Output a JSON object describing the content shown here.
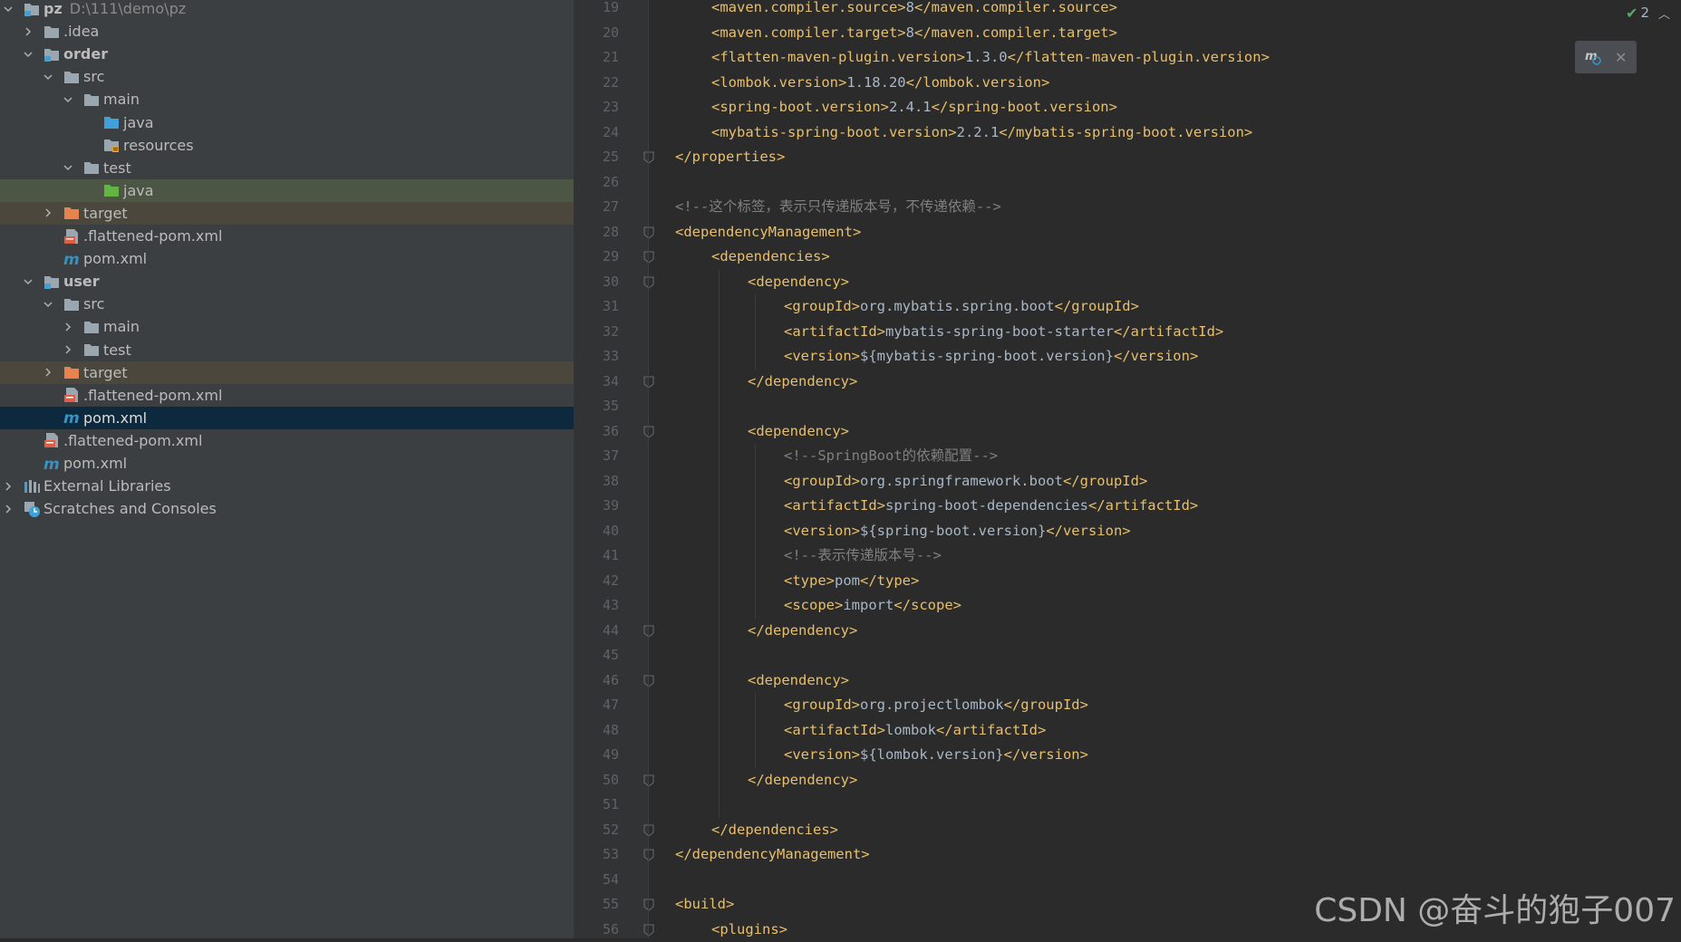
{
  "tree": {
    "rows": [
      {
        "label": "pz",
        "path": "D:\\111\\demo\\pz",
        "bold": true
      },
      {
        "label": ".idea"
      },
      {
        "label": "order",
        "bold": true
      },
      {
        "label": "src"
      },
      {
        "label": "main"
      },
      {
        "label": "java"
      },
      {
        "label": "resources"
      },
      {
        "label": "test"
      },
      {
        "label": "java"
      },
      {
        "label": "target"
      },
      {
        "label": ".flattened-pom.xml"
      },
      {
        "label": "pom.xml"
      },
      {
        "label": "user",
        "bold": true
      },
      {
        "label": "src"
      },
      {
        "label": "main"
      },
      {
        "label": "test"
      },
      {
        "label": "target"
      },
      {
        "label": ".flattened-pom.xml"
      },
      {
        "label": "pom.xml"
      },
      {
        "label": ".flattened-pom.xml"
      },
      {
        "label": "pom.xml"
      },
      {
        "label": "External Libraries"
      },
      {
        "label": "Scratches and Consoles"
      }
    ]
  },
  "editor": {
    "line_numbers": [
      "19",
      "20",
      "21",
      "22",
      "23",
      "24",
      "25",
      "26",
      "27",
      "28",
      "29",
      "30",
      "31",
      "32",
      "33",
      "34",
      "35",
      "36",
      "37",
      "38",
      "39",
      "40",
      "41",
      "42",
      "43",
      "44",
      "45",
      "46",
      "47",
      "48",
      "49",
      "50",
      "51",
      "52",
      "53",
      "54",
      "55",
      "56"
    ],
    "lines": [
      {
        "open": "<maven.compiler.source>",
        "text": "8",
        "close": "</maven.compiler.source>"
      },
      {
        "open": "<maven.compiler.target>",
        "text": "8",
        "close": "</maven.compiler.target>"
      },
      {
        "open": "<flatten-maven-plugin.version>",
        "text": "1.3.0",
        "close": "</flatten-maven-plugin.version>"
      },
      {
        "open": "<lombok.version>",
        "text": "1.18.20",
        "close": "</lombok.version>"
      },
      {
        "open": "<spring-boot.version>",
        "text": "2.4.1",
        "close": "</spring-boot.version>"
      },
      {
        "open": "<mybatis-spring-boot.version>",
        "text": "2.2.1",
        "close": "</mybatis-spring-boot.version>"
      },
      {
        "open": "</properties>"
      },
      {},
      {
        "comment": "<!--这个标签，表示只传递版本号，不传递依赖-->"
      },
      {
        "open": "<dependencyManagement>"
      },
      {
        "open": "<dependencies>"
      },
      {
        "open": "<dependency>"
      },
      {
        "open": "<groupId>",
        "text": "org.mybatis.spring.boot",
        "close": "</groupId>"
      },
      {
        "open": "<artifactId>",
        "text": "mybatis-spring-boot-starter",
        "close": "</artifactId>"
      },
      {
        "open": "<version>",
        "text": "${mybatis-spring-boot.version}",
        "close": "</version>"
      },
      {
        "open": "</dependency>"
      },
      {},
      {
        "open": "<dependency>"
      },
      {
        "comment": "<!--SpringBoot的依赖配置-->"
      },
      {
        "open": "<groupId>",
        "text": "org.springframework.boot",
        "close": "</groupId>"
      },
      {
        "open": "<artifactId>",
        "text": "spring-boot-dependencies",
        "close": "</artifactId>"
      },
      {
        "open": "<version>",
        "text": "${spring-boot.version}",
        "close": "</version>"
      },
      {
        "comment": "<!--表示传递版本号-->"
      },
      {
        "open": "<type>",
        "text": "pom",
        "close": "</type>"
      },
      {
        "open": "<scope>",
        "text": "import",
        "close": "</scope>"
      },
      {
        "open": "</dependency>"
      },
      {},
      {
        "open": "<dependency>"
      },
      {
        "open": "<groupId>",
        "text": "org.projectlombok",
        "close": "</groupId>"
      },
      {
        "open": "<artifactId>",
        "text": "lombok",
        "close": "</artifactId>"
      },
      {
        "open": "<version>",
        "text": "${lombok.version}",
        "close": "</version>"
      },
      {
        "open": "</dependency>"
      },
      {},
      {
        "open": "</dependencies>"
      },
      {
        "open": "</dependencyManagement>"
      },
      {},
      {
        "open": "<build>"
      },
      {
        "open": "<plugins>"
      }
    ]
  },
  "inspections": {
    "count": "2"
  },
  "watermark": "CSDN @奋斗的狍子007",
  "colors": {
    "tag": "#e8bf6a",
    "text": "#a9b7c6",
    "comment": "#808080",
    "selection": "#0d293e",
    "target_row": "#4b473d"
  }
}
